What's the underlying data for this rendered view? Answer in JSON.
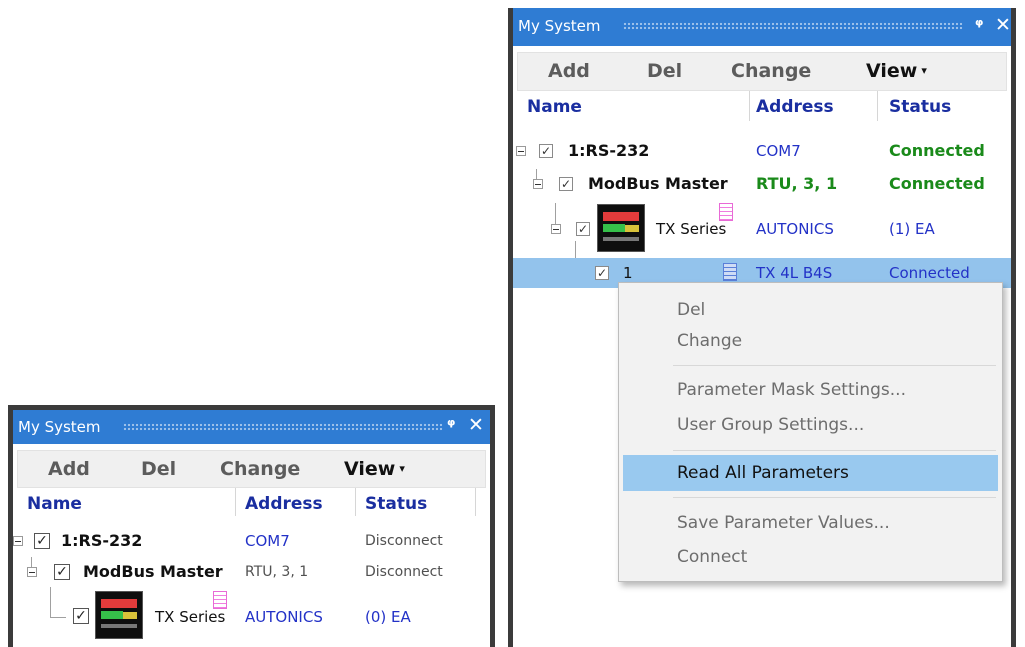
{
  "panel_right": {
    "title": "My System",
    "pin_icon": "📌",
    "toolbar": {
      "add": "Add",
      "del": "Del",
      "change": "Change",
      "view": "View",
      "view_caret": "▾"
    },
    "columns": {
      "name": "Name",
      "address": "Address",
      "status": "Status"
    },
    "rows": [
      {
        "name": "1:RS-232",
        "address": "COM7",
        "status": "Connected"
      },
      {
        "name": "ModBus Master",
        "address": "RTU, 3, 1",
        "status": "Connected"
      },
      {
        "name": "TX Series",
        "address": "AUTONICS",
        "status": "(1) EA"
      },
      {
        "name": "1",
        "address": "TX 4L B4S",
        "status": "Connected"
      }
    ]
  },
  "panel_left": {
    "title": "My System",
    "toolbar": {
      "add": "Add",
      "del": "Del",
      "change": "Change",
      "view": "View",
      "view_caret": "▾"
    },
    "columns": {
      "name": "Name",
      "address": "Address",
      "status": "Status"
    },
    "rows": [
      {
        "name": "1:RS-232",
        "address": "COM7",
        "status": "Disconnect"
      },
      {
        "name": "ModBus Master",
        "address": "RTU, 3, 1",
        "status": "Disconnect"
      },
      {
        "name": "TX Series",
        "address": "AUTONICS",
        "status": "(0) EA"
      }
    ]
  },
  "context_menu": {
    "items": [
      {
        "label": "Del"
      },
      {
        "label": "Change"
      },
      {
        "label": "Parameter Mask Settings..."
      },
      {
        "label": "User Group Settings..."
      },
      {
        "label": "Read All Parameters",
        "highlighted": true
      },
      {
        "label": "Save Parameter Values..."
      },
      {
        "label": "Connect"
      }
    ]
  },
  "colors": {
    "titlebar": "#2f7cd3",
    "connected": "#1a8a1a",
    "selection": "#93c3ec",
    "menu_highlight": "#99c9ef",
    "header_text": "#1a2ea0"
  },
  "icons": {
    "checkbox": "✓",
    "close": "✕"
  }
}
